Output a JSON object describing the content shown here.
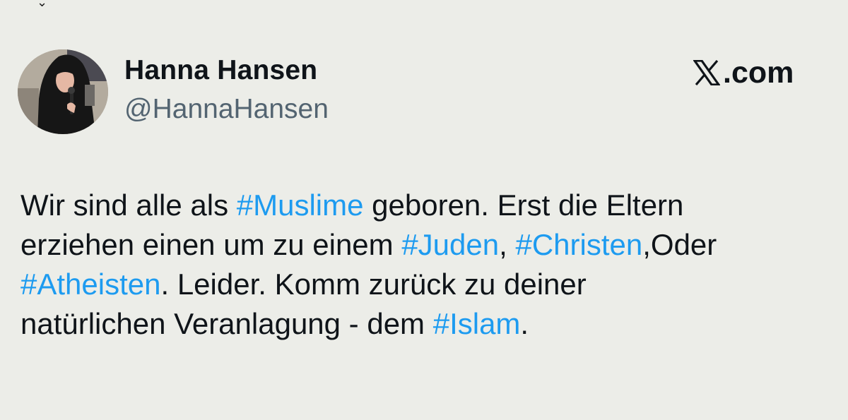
{
  "author": {
    "name": "Hanna Hansen",
    "handle": "@HannaHansen"
  },
  "brand": {
    "text": ".com",
    "icon": "x-logo-icon"
  },
  "tweet": {
    "lines": [
      [
        {
          "type": "text",
          "text": "Wir sind alle als "
        },
        {
          "type": "hashtag",
          "text": "#Muslime"
        },
        {
          "type": "text",
          "text": " geboren. Erst die Eltern"
        }
      ],
      [
        {
          "type": "text",
          "text": "erziehen einen um zu einem "
        },
        {
          "type": "hashtag",
          "text": "#Juden"
        },
        {
          "type": "text",
          "text": ", "
        },
        {
          "type": "hashtag",
          "text": "#Christen"
        },
        {
          "type": "text",
          "text": ",Oder"
        }
      ],
      [
        {
          "type": "hashtag",
          "text": "#Atheisten"
        },
        {
          "type": "text",
          "text": ". Leider. Komm zurück zu deiner"
        }
      ],
      [
        {
          "type": "text",
          "text": "natürlichen Veranlagung - dem "
        },
        {
          "type": "hashtag",
          "text": "#Islam"
        },
        {
          "type": "text",
          "text": "."
        }
      ]
    ]
  },
  "colors": {
    "background": "#ecede8",
    "text": "#0f1419",
    "handle": "#536471",
    "hashtag": "#1d9bf0"
  }
}
